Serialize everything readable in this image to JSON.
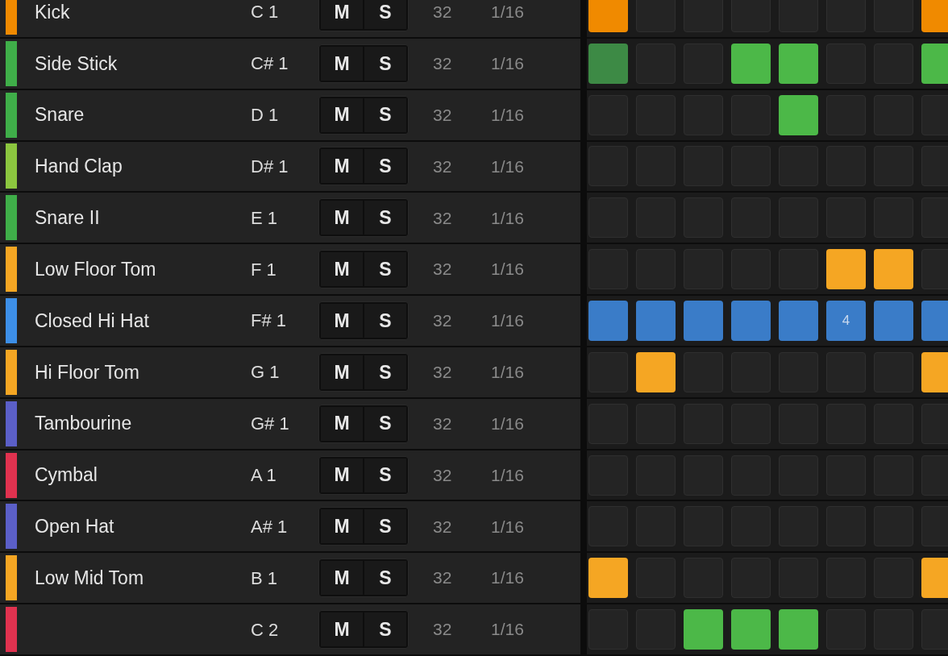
{
  "tracks": [
    {
      "name": "Kick",
      "note": "C 1",
      "color": "#f08a00",
      "mute": {
        "label": "M",
        "on": false
      },
      "solo": {
        "label": "S",
        "on": false
      },
      "steps_count": "32",
      "resolution": "1/16",
      "steps": [
        {
          "on": true,
          "color": "#f08a00"
        },
        {
          "on": false
        },
        {
          "on": false
        },
        {
          "on": false
        },
        {
          "on": false
        },
        {
          "on": false
        },
        {
          "on": false
        },
        {
          "on": true,
          "color": "#f08a00"
        }
      ]
    },
    {
      "name": "Side Stick",
      "note": "C# 1",
      "color": "#3fae49",
      "mute": {
        "label": "M",
        "on": false
      },
      "solo": {
        "label": "S",
        "on": false
      },
      "steps_count": "32",
      "resolution": "1/16",
      "steps": [
        {
          "on": true,
          "color": "#3d8a45"
        },
        {
          "on": false
        },
        {
          "on": false
        },
        {
          "on": true,
          "color": "#4cb848"
        },
        {
          "on": true,
          "color": "#4cb848"
        },
        {
          "on": false
        },
        {
          "on": false
        },
        {
          "on": true,
          "color": "#4cb848"
        }
      ]
    },
    {
      "name": "Snare",
      "note": "D 1",
      "color": "#3fae49",
      "mute": {
        "label": "M",
        "on": false
      },
      "solo": {
        "label": "S",
        "on": false
      },
      "steps_count": "32",
      "resolution": "1/16",
      "steps": [
        {
          "on": false
        },
        {
          "on": false
        },
        {
          "on": false
        },
        {
          "on": false
        },
        {
          "on": true,
          "color": "#4cb848"
        },
        {
          "on": false
        },
        {
          "on": false
        },
        {
          "on": false
        }
      ]
    },
    {
      "name": "Hand Clap",
      "note": "D# 1",
      "color": "#8cc63f",
      "mute": {
        "label": "M",
        "on": false
      },
      "solo": {
        "label": "S",
        "on": false
      },
      "steps_count": "32",
      "resolution": "1/16",
      "steps": [
        {
          "on": false
        },
        {
          "on": false
        },
        {
          "on": false
        },
        {
          "on": false
        },
        {
          "on": false
        },
        {
          "on": false
        },
        {
          "on": false
        },
        {
          "on": false
        }
      ]
    },
    {
      "name": "Snare II",
      "note": "E 1",
      "color": "#3fae49",
      "mute": {
        "label": "M",
        "on": false
      },
      "solo": {
        "label": "S",
        "on": false
      },
      "steps_count": "32",
      "resolution": "1/16",
      "steps": [
        {
          "on": false
        },
        {
          "on": false
        },
        {
          "on": false
        },
        {
          "on": false
        },
        {
          "on": false
        },
        {
          "on": false
        },
        {
          "on": false
        },
        {
          "on": false
        }
      ]
    },
    {
      "name": "Low Floor Tom",
      "note": "F 1",
      "color": "#f5a623",
      "mute": {
        "label": "M",
        "on": false
      },
      "solo": {
        "label": "S",
        "on": false
      },
      "steps_count": "32",
      "resolution": "1/16",
      "steps": [
        {
          "on": false
        },
        {
          "on": false
        },
        {
          "on": false
        },
        {
          "on": false
        },
        {
          "on": false
        },
        {
          "on": true,
          "color": "#f5a623"
        },
        {
          "on": true,
          "color": "#f5a623"
        },
        {
          "on": false
        }
      ]
    },
    {
      "name": "Closed Hi Hat",
      "note": "F# 1",
      "color": "#3d8fe8",
      "mute": {
        "label": "M",
        "on": false
      },
      "solo": {
        "label": "S",
        "on": false
      },
      "steps_count": "32",
      "resolution": "1/16",
      "steps": [
        {
          "on": true,
          "color": "#3a7cc8"
        },
        {
          "on": true,
          "color": "#3a7cc8"
        },
        {
          "on": true,
          "color": "#3a7cc8"
        },
        {
          "on": true,
          "color": "#3a7cc8"
        },
        {
          "on": true,
          "color": "#3a7cc8"
        },
        {
          "on": true,
          "color": "#3a7cc8",
          "label": "4"
        },
        {
          "on": true,
          "color": "#3a7cc8"
        },
        {
          "on": true,
          "color": "#3a7cc8"
        }
      ]
    },
    {
      "name": "Hi Floor Tom",
      "note": "G 1",
      "color": "#f5a623",
      "mute": {
        "label": "M",
        "on": false
      },
      "solo": {
        "label": "S",
        "on": false
      },
      "steps_count": "32",
      "resolution": "1/16",
      "steps": [
        {
          "on": false
        },
        {
          "on": true,
          "color": "#f5a623"
        },
        {
          "on": false
        },
        {
          "on": false
        },
        {
          "on": false
        },
        {
          "on": false
        },
        {
          "on": false
        },
        {
          "on": true,
          "color": "#f5a623"
        }
      ]
    },
    {
      "name": "Tambourine",
      "note": "G# 1",
      "color": "#5b5fc7",
      "mute": {
        "label": "M",
        "on": false
      },
      "solo": {
        "label": "S",
        "on": false
      },
      "steps_count": "32",
      "resolution": "1/16",
      "steps": [
        {
          "on": false
        },
        {
          "on": false
        },
        {
          "on": false
        },
        {
          "on": false
        },
        {
          "on": false
        },
        {
          "on": false
        },
        {
          "on": false
        },
        {
          "on": false
        }
      ]
    },
    {
      "name": "Cymbal",
      "note": "A 1",
      "color": "#e0324f",
      "mute": {
        "label": "M",
        "on": false
      },
      "solo": {
        "label": "S",
        "on": false
      },
      "steps_count": "32",
      "resolution": "1/16",
      "steps": [
        {
          "on": false
        },
        {
          "on": false
        },
        {
          "on": false
        },
        {
          "on": false
        },
        {
          "on": false
        },
        {
          "on": false
        },
        {
          "on": false
        },
        {
          "on": false
        }
      ]
    },
    {
      "name": "Open Hat",
      "note": "A# 1",
      "color": "#5b5fc7",
      "mute": {
        "label": "M",
        "on": false
      },
      "solo": {
        "label": "S",
        "on": false
      },
      "steps_count": "32",
      "resolution": "1/16",
      "steps": [
        {
          "on": false
        },
        {
          "on": false
        },
        {
          "on": false
        },
        {
          "on": false
        },
        {
          "on": false
        },
        {
          "on": false
        },
        {
          "on": false
        },
        {
          "on": false
        }
      ]
    },
    {
      "name": "Low Mid Tom",
      "note": "B 1",
      "color": "#f5a623",
      "mute": {
        "label": "M",
        "on": false
      },
      "solo": {
        "label": "S",
        "on": false
      },
      "steps_count": "32",
      "resolution": "1/16",
      "steps": [
        {
          "on": true,
          "color": "#f5a623"
        },
        {
          "on": false
        },
        {
          "on": false
        },
        {
          "on": false
        },
        {
          "on": false
        },
        {
          "on": false
        },
        {
          "on": false
        },
        {
          "on": true,
          "color": "#f5a623"
        }
      ]
    },
    {
      "note": "C 2",
      "color": "#e0324f",
      "mute": {
        "label": "M",
        "on": false
      },
      "solo": {
        "label": "S",
        "on": false
      },
      "steps_count": "32",
      "resolution": "1/16",
      "steps": [
        {
          "on": false
        },
        {
          "on": false
        },
        {
          "on": true,
          "color": "#4cb848"
        },
        {
          "on": true,
          "color": "#4cb848"
        },
        {
          "on": true,
          "color": "#4cb848"
        },
        {
          "on": false
        },
        {
          "on": false
        },
        {
          "on": false
        }
      ]
    }
  ]
}
